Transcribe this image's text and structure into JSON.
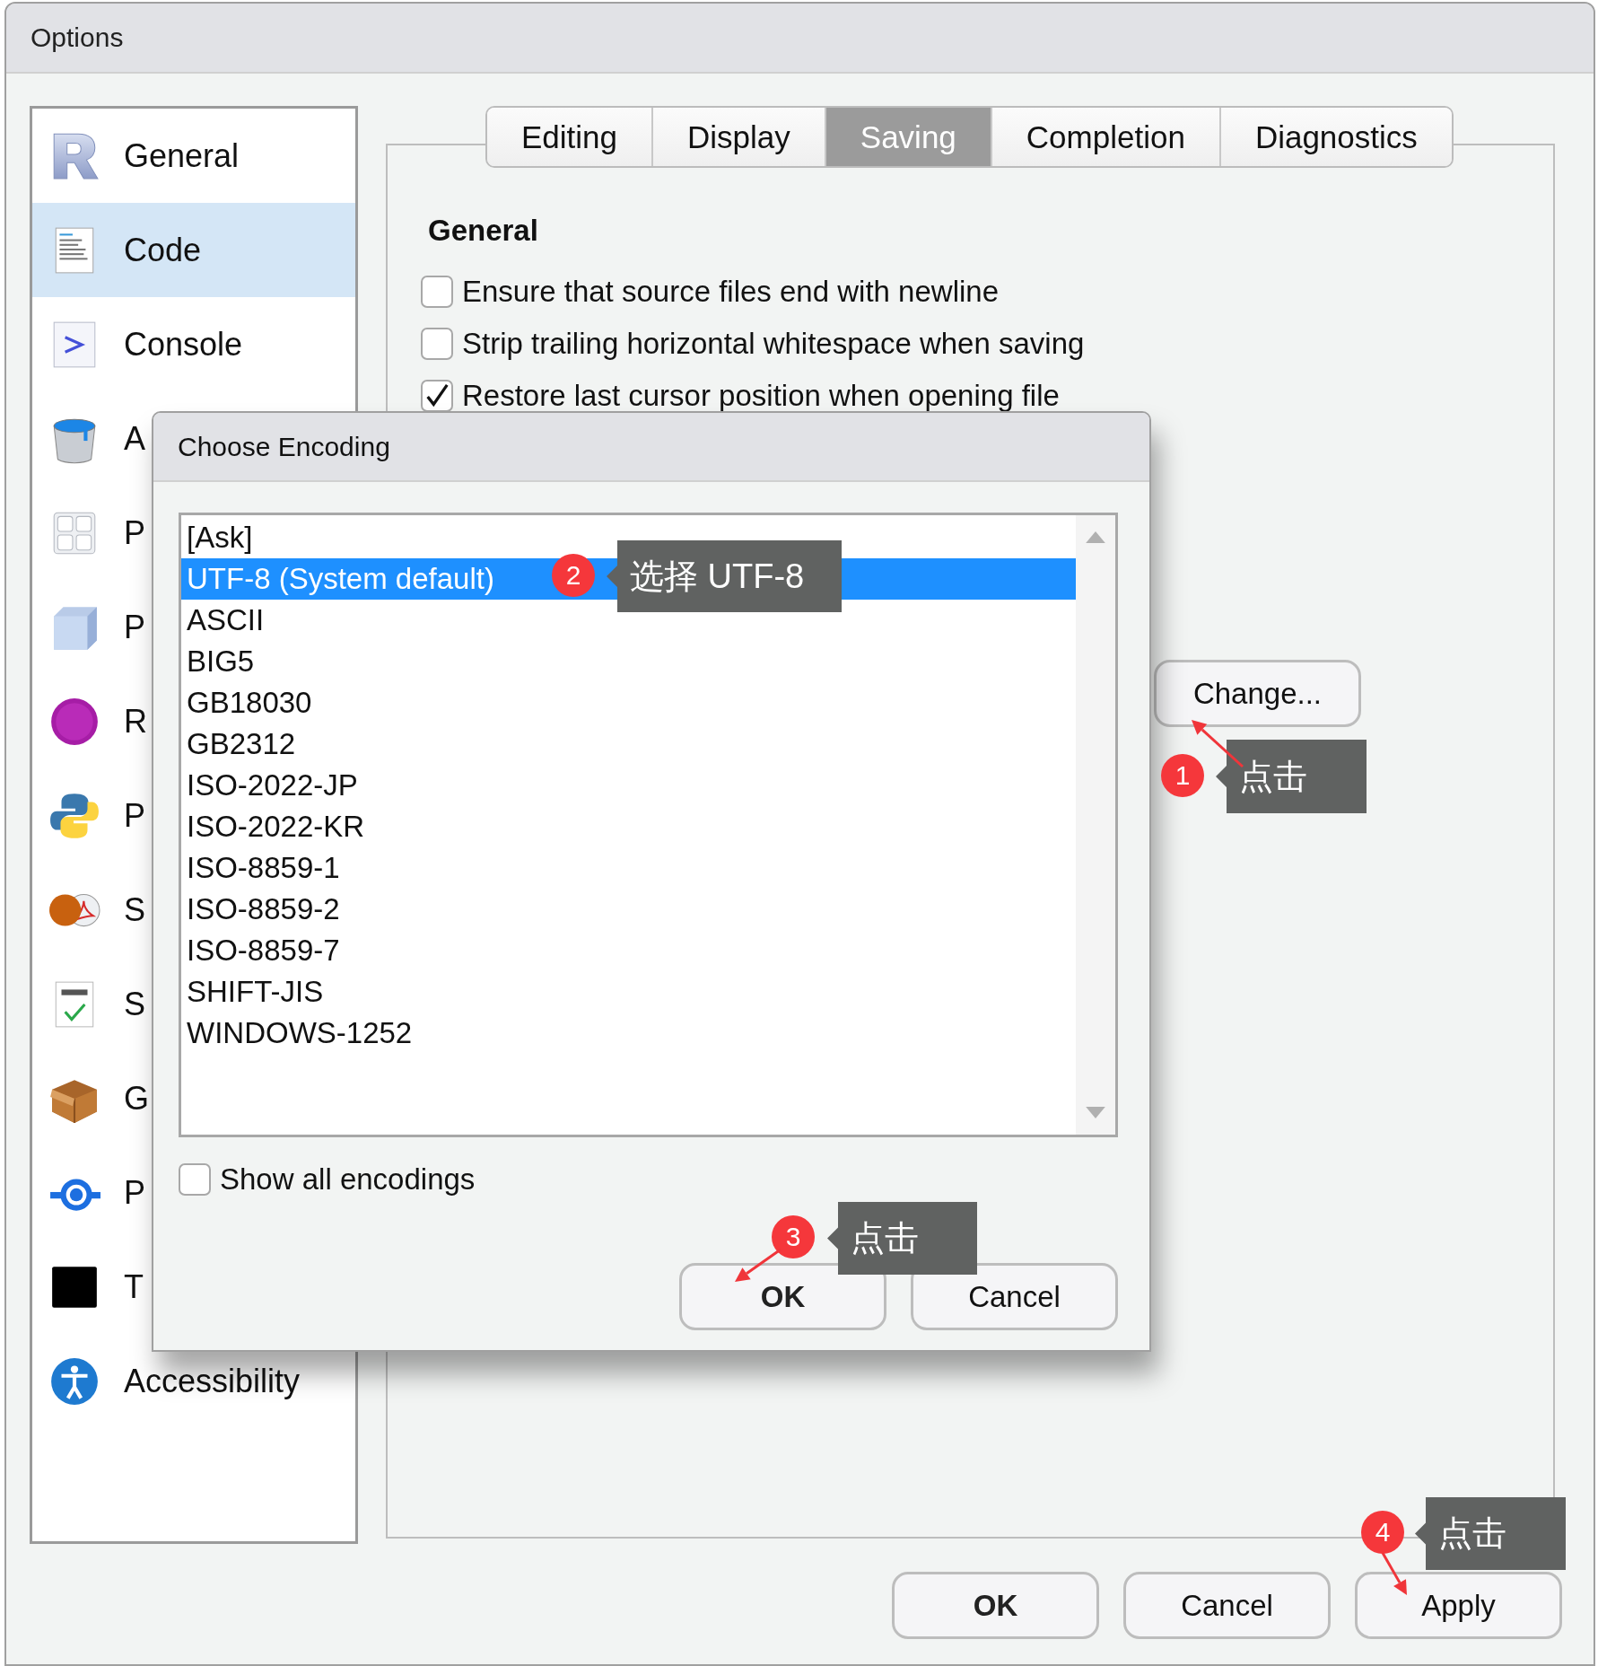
{
  "window": {
    "title": "Options"
  },
  "sidebar": {
    "items": [
      {
        "label": "General",
        "selected": false
      },
      {
        "label": "Code",
        "selected": true
      },
      {
        "label": "Console",
        "selected": false
      },
      {
        "label": "A",
        "selected": false
      },
      {
        "label": "P",
        "selected": false
      },
      {
        "label": "P",
        "selected": false
      },
      {
        "label": "R",
        "selected": false
      },
      {
        "label": "P",
        "selected": false
      },
      {
        "label": "S",
        "selected": false
      },
      {
        "label": "S",
        "selected": false
      },
      {
        "label": "G",
        "selected": false
      },
      {
        "label": "P",
        "selected": false
      },
      {
        "label": "T",
        "selected": false
      },
      {
        "label": "Accessibility",
        "selected": false
      }
    ]
  },
  "tabs": [
    {
      "label": "Editing",
      "selected": false
    },
    {
      "label": "Display",
      "selected": false
    },
    {
      "label": "Saving",
      "selected": true
    },
    {
      "label": "Completion",
      "selected": false
    },
    {
      "label": "Diagnostics",
      "selected": false
    }
  ],
  "section": {
    "heading": "General",
    "options": [
      {
        "label": "Ensure that source files end with newline",
        "checked": false
      },
      {
        "label": "Strip trailing horizontal whitespace when saving",
        "checked": false
      },
      {
        "label": "Restore last cursor position when opening file",
        "checked": true
      }
    ],
    "change_button": "Change..."
  },
  "buttons": [
    {
      "label": "OK",
      "default": true
    },
    {
      "label": "Cancel",
      "default": false
    },
    {
      "label": "Apply",
      "default": false
    }
  ],
  "dialog": {
    "title": "Choose Encoding",
    "encodings": [
      {
        "label": "[Ask]",
        "selected": false
      },
      {
        "label": "UTF-8 (System default)",
        "selected": true
      },
      {
        "label": "ASCII",
        "selected": false
      },
      {
        "label": "BIG5",
        "selected": false
      },
      {
        "label": "GB18030",
        "selected": false
      },
      {
        "label": "GB2312",
        "selected": false
      },
      {
        "label": "ISO-2022-JP",
        "selected": false
      },
      {
        "label": "ISO-2022-KR",
        "selected": false
      },
      {
        "label": "ISO-8859-1",
        "selected": false
      },
      {
        "label": "ISO-8859-2",
        "selected": false
      },
      {
        "label": "ISO-8859-7",
        "selected": false
      },
      {
        "label": "SHIFT-JIS",
        "selected": false
      },
      {
        "label": "WINDOWS-1252",
        "selected": false
      }
    ],
    "show_all": {
      "label": "Show all encodings",
      "checked": false
    },
    "buttons": [
      {
        "label": "OK",
        "default": true
      },
      {
        "label": "Cancel",
        "default": false
      }
    ]
  },
  "annotations": [
    {
      "number": "1",
      "text": "点击"
    },
    {
      "number": "2",
      "text": "选择 UTF-8"
    },
    {
      "number": "3",
      "text": "点击"
    },
    {
      "number": "4",
      "text": "点击"
    }
  ]
}
